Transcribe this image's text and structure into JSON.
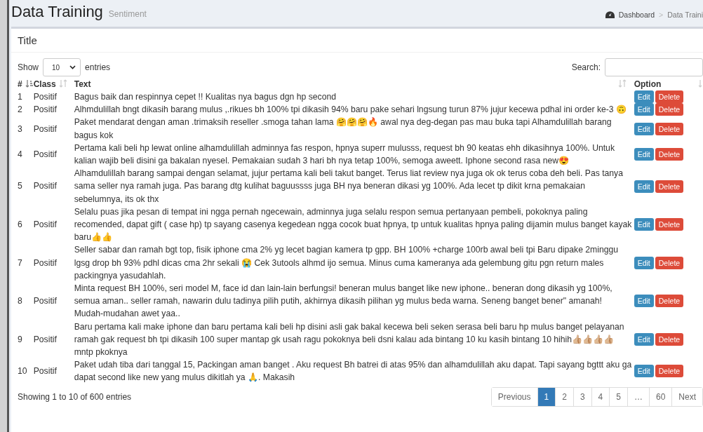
{
  "header": {
    "title": "Data Training",
    "subtitle": "Sentiment",
    "breadcrumb": [
      {
        "label": "Dashboard"
      },
      {
        "label": "Data Traini"
      }
    ],
    "breadcrumb_separator": ">"
  },
  "card": {
    "title": "Title"
  },
  "length": {
    "before": "Show",
    "value": "10",
    "after": "entries"
  },
  "search": {
    "label": "Search:"
  },
  "table": {
    "columns": [
      {
        "label": "#",
        "sorted": true
      },
      {
        "label": "Class",
        "sorted": false
      },
      {
        "label": "Text",
        "sorted": false
      },
      {
        "label": "Option",
        "sorted": false
      }
    ],
    "rows": [
      {
        "no": "1",
        "class": "Positif",
        "text": "Bagus baik dan respinnya cepet !! Kualitas nya bagus dgn hp second",
        "actions": [
          {
            "label": "Edit",
            "kind": "edit"
          },
          {
            "label": "Delete",
            "kind": "delete"
          }
        ]
      },
      {
        "no": "2",
        "class": "Positif",
        "text": "Alhmdulillah bngt dikasih barang mulus ,.rikues bh 100% tpi dikasih 94% baru pake sehari lngsung turun 87% jujur kecewa pdhal ini order ke-3 🙃",
        "actions": [
          {
            "label": "Edit",
            "kind": "edit"
          },
          {
            "label": "Delete",
            "kind": "delete"
          }
        ]
      },
      {
        "no": "3",
        "class": "Positif",
        "text": "Paket mendarat dengan aman .trimaksih reseller .smoga tahan lama 🤗🤗🤗🔥 awal nya deg-degan pas mau buka tapi Alhamdulillah barang bagus kok",
        "actions": [
          {
            "label": "Edit",
            "kind": "edit"
          },
          {
            "label": "Delete",
            "kind": "delete"
          }
        ]
      },
      {
        "no": "4",
        "class": "Positif",
        "text": "Pertama kali beli hp lewat online alhamdulillah adminnya fas respon, hpnya superr mulusss, request bh 90 keatas ehh dikasihnya 100%. Untuk kalian wajib beli disini ga bakalan nyesel. Pemakaian sudah 3 hari bh nya tetap 100%, semoga aweett. Iphone second rasa new😍",
        "actions": [
          {
            "label": "Edit",
            "kind": "edit"
          },
          {
            "label": "Delete",
            "kind": "delete"
          }
        ]
      },
      {
        "no": "5",
        "class": "Positif",
        "text": "Alhamdulillah barang sampai dengan selamat, jujur pertama kali beli takut banget. Terus liat review nya juga ok ok terus coba deh beli. Pas tanya sama seller nya ramah juga. Pas barang dtg kulihat baguussss juga BH nya beneran dikasi yg 100%. Ada lecet tp dikit krna pemakaian sebelumnya, its ok thx",
        "actions": [
          {
            "label": "Edit",
            "kind": "edit"
          },
          {
            "label": "Delete",
            "kind": "delete"
          }
        ]
      },
      {
        "no": "6",
        "class": "Positif",
        "text": "Selalu puas jika pesan di tempat ini ngga pernah ngecewain, adminnya juga selalu respon semua pertanyaan pembeli, pokoknya paling recomended, dapat gift ( case hp) tp sayang casenya kegedean ngga cocok buat hpnya, tp untuk kualitas hpnya paling dijamin mulus banget kayak baru👍👍",
        "actions": [
          {
            "label": "Edit",
            "kind": "edit"
          },
          {
            "label": "Delete",
            "kind": "delete"
          }
        ]
      },
      {
        "no": "7",
        "class": "Positif",
        "text": "Seller sabar dan ramah bgt top, fisik iphone cma 2% yg lecet bagian kamera tp gpp. BH 100% +charge 100rb awal beli tpi Baru dipake 2minggu lgsg drop bh 93% pdhl dicas cma 2hr sekali 😭 Cek 3utools alhmd ijo semua. Minus cuma kameranya ada gelembung gitu pgn return males packingnya yasudahlah.",
        "actions": [
          {
            "label": "Edit",
            "kind": "edit"
          },
          {
            "label": "Delete",
            "kind": "delete"
          }
        ]
      },
      {
        "no": "8",
        "class": "Positif",
        "text": "Minta request BH 100%, seri model M, face id dan lain-lain berfungsi! beneran mulus banget like new iphone.. beneran dong dikasih yg 100%, semua aman.. seller ramah, nawarin dulu tadinya pilih putih, akhirnya dikasih pilihan yg mulus beda warna. Seneng banget bener\" amanah! Mudah-mudahan awet yaa..",
        "actions": [
          {
            "label": "Edit",
            "kind": "edit"
          },
          {
            "label": "Delete",
            "kind": "delete"
          }
        ]
      },
      {
        "no": "9",
        "class": "Positif",
        "text": "Baru pertama kali make iphone dan baru pertama kali beli hp disini asli gak bakal kecewa beli seken serasa beli baru hp mulus banget pelayanan ramah gak request bh tpi dikasih 100 super mantap gk usah ragu pokoknya beli dsni kalau ada bintang 10 ku kasih bintang 10 hihih👍🏼👍🏼👍🏼👍🏼mntp pkoknya",
        "actions": [
          {
            "label": "Edit",
            "kind": "edit"
          },
          {
            "label": "Delete",
            "kind": "delete"
          }
        ]
      },
      {
        "no": "10",
        "class": "Positif",
        "text": "Paket udah tiba dari tanggal 15, Packingan aman banget . Aku request Bh batrei di atas 95% dan alhamdulillah aku dapat. Tapi sayang bgttt aku ga dapat second like new yang mulus dikitlah ya 🙏. Makasih",
        "actions": [
          {
            "label": "Edit",
            "kind": "edit"
          },
          {
            "label": "Delete",
            "kind": "delete"
          }
        ]
      }
    ]
  },
  "info": "Showing 1 to 10 of 600 entries",
  "pagination": [
    {
      "label": "Previous",
      "selected": false
    },
    {
      "label": "1",
      "selected": true
    },
    {
      "label": "2",
      "selected": false
    },
    {
      "label": "3",
      "selected": false
    },
    {
      "label": "4",
      "selected": false
    },
    {
      "label": "5",
      "selected": false
    },
    {
      "label": "…",
      "selected": false
    },
    {
      "label": "60",
      "selected": false
    },
    {
      "label": "Next",
      "selected": false
    }
  ]
}
